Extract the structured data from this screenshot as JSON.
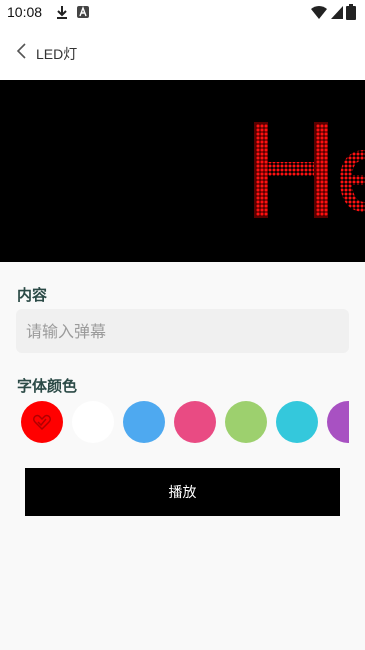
{
  "status_bar": {
    "time": "10:08",
    "icons": [
      "download-icon",
      "app-a-icon",
      "wifi-icon",
      "signal-icon",
      "battery-icon"
    ]
  },
  "header": {
    "back_icon": "chevron-left-icon",
    "title": "LED灯"
  },
  "preview": {
    "text_visible": "He",
    "text_color": "#ff0000",
    "background": "#000000"
  },
  "content": {
    "label": "内容",
    "input_value": "",
    "input_placeholder": "请输入弹幕"
  },
  "font_color": {
    "label": "字体颜色",
    "selected_index": 0,
    "options": [
      {
        "name": "red",
        "color": "#ff0000"
      },
      {
        "name": "white",
        "color": "#ffffff"
      },
      {
        "name": "blue",
        "color": "#4ea9f0"
      },
      {
        "name": "pink",
        "color": "#e94b83"
      },
      {
        "name": "green",
        "color": "#9dd06e"
      },
      {
        "name": "cyan",
        "color": "#34c8dc"
      },
      {
        "name": "purple",
        "color": "#a851c2"
      }
    ]
  },
  "actions": {
    "play_label": "播放"
  }
}
